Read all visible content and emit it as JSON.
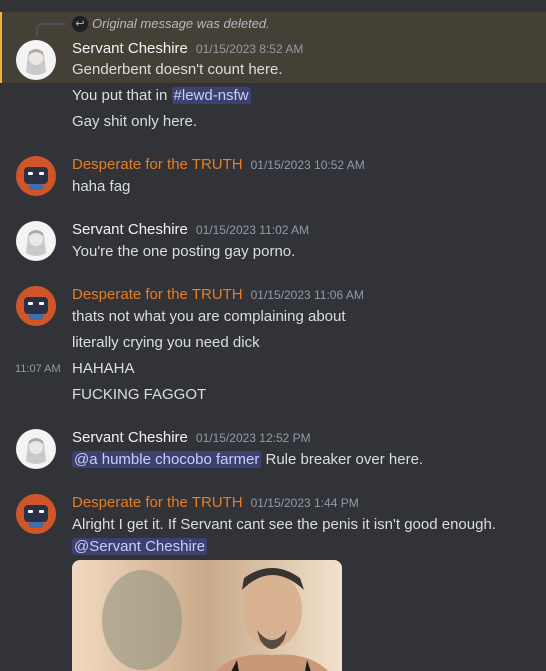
{
  "reply": {
    "text": "Original message was deleted."
  },
  "messages": [
    {
      "author": "Servant Cheshire",
      "timestamp": "01/15/2023 8:52 AM",
      "lines": [
        "Genderbent doesn't count here.",
        "You put that in ",
        "Gay shit only here."
      ],
      "channel": "#lewd-nsfw"
    },
    {
      "author": "Desperate for the TRUTH",
      "timestamp": "01/15/2023 10:52 AM",
      "lines": [
        "haha fag"
      ]
    },
    {
      "author": "Servant Cheshire",
      "timestamp": "01/15/2023 11:02 AM",
      "lines": [
        "You're the one posting gay porno."
      ]
    },
    {
      "author": "Desperate for the TRUTH",
      "timestamp": "01/15/2023 11:06 AM",
      "lines": [
        "thats not what you are complaining about",
        "literally crying you need dick"
      ]
    },
    {
      "side_timestamp": "11:07 AM",
      "lines": [
        "HAHAHA",
        "FUCKING FAGGOT"
      ]
    },
    {
      "author": "Servant Cheshire",
      "timestamp": "01/15/2023 12:52 PM",
      "mention": "@a humble chocobo farmer",
      "lines": [
        " Rule breaker over here."
      ]
    },
    {
      "author": "Desperate for the TRUTH",
      "timestamp": "01/15/2023 1:44 PM",
      "lines": [
        "Alright I get it. If Servant cant see the penis it isn't good enough."
      ],
      "mention": "@Servant Cheshire"
    }
  ],
  "colors": {
    "background": "#313338",
    "highlight": "#444036",
    "desperate_name": "#e67e22",
    "mention_bg": "#3c4270"
  }
}
